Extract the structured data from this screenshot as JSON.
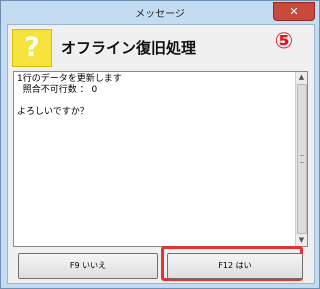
{
  "window": {
    "title": "メッセージ",
    "close_label": "✕"
  },
  "header": {
    "icon_glyph": "?",
    "title": "オフライン復旧処理",
    "step_badge": "⑤"
  },
  "message": {
    "lines": [
      "1行のデータを更新します",
      "  照合不可行数 ： 0",
      "",
      "よろしいですか？"
    ]
  },
  "buttons": {
    "no_label": "F9  いいえ",
    "yes_label": "F12  はい"
  },
  "colors": {
    "highlight": "#e23434",
    "icon_bg": "#f6e33c"
  }
}
